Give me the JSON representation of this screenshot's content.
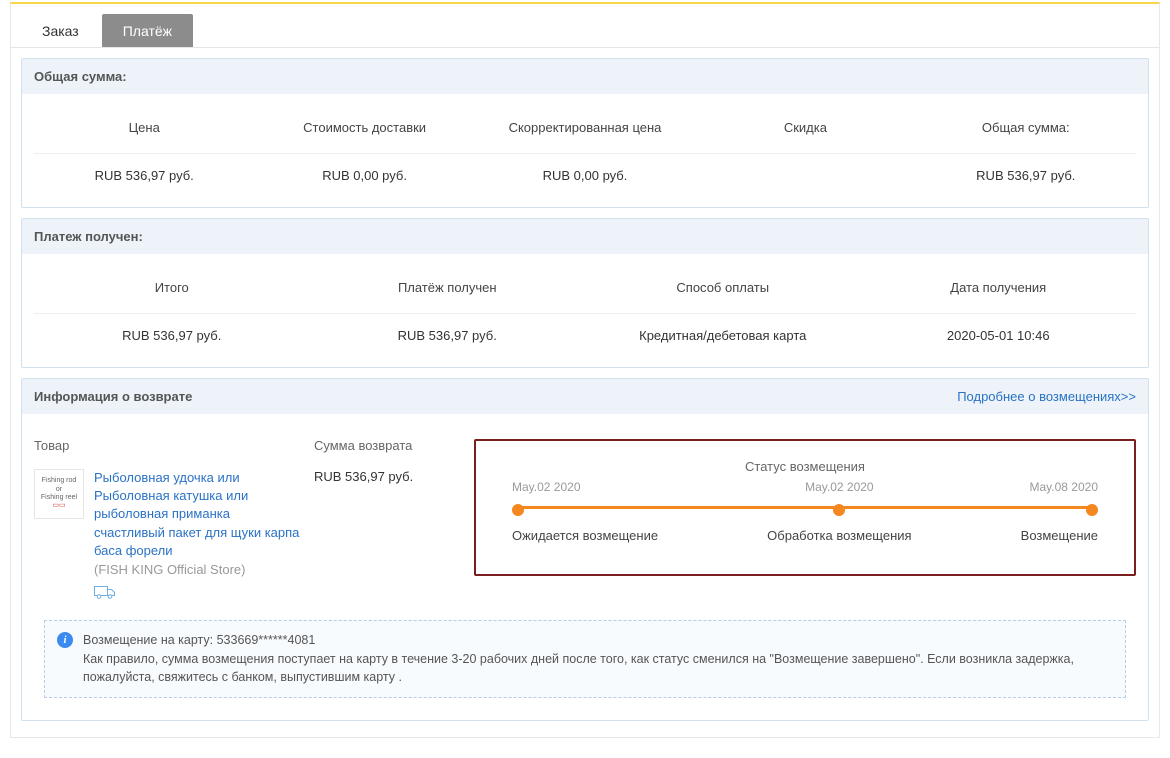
{
  "tabs": {
    "order": "Заказ",
    "payment": "Платёж"
  },
  "total": {
    "header": "Общая сумма:",
    "cols": {
      "price": "Цена",
      "ship": "Стоимость доставки",
      "adj": "Скорректированная цена",
      "disc": "Скидка",
      "total": "Общая сумма:"
    },
    "vals": {
      "price": "RUB 536,97 руб.",
      "ship": "RUB 0,00 руб.",
      "adj": "RUB 0,00 руб.",
      "disc": "",
      "total": "RUB 536,97 руб."
    }
  },
  "received": {
    "header": "Платеж получен:",
    "cols": {
      "total": "Итого",
      "recv": "Платёж получен",
      "method": "Способ оплаты",
      "date": "Дата получения"
    },
    "vals": {
      "total": "RUB 536,97 руб.",
      "recv": "RUB 536,97 руб.",
      "method": "Кредитная/дебетовая карта",
      "date": "2020-05-01 10:46"
    }
  },
  "refund": {
    "header": "Информация о возврате",
    "more": "Подробнее о возмещениях>>",
    "cols": {
      "product": "Товар",
      "amount": "Сумма возврата",
      "status": "Статус возмещения"
    },
    "product": {
      "title": "Рыболовная удочка или Рыболовная катушка или рыболовная приманка счастливый пакет для щуки карпа баса форели",
      "store": "(FISH KING Official Store)",
      "thumb1": "Fishing rod",
      "thumb_or": "or",
      "thumb2": "Fishing reel"
    },
    "amount": "RUB 536,97 руб.",
    "steps": [
      {
        "date": "May.02 2020",
        "label": "Ожидается возмещение"
      },
      {
        "date": "May.02 2020",
        "label": "Обработка возмещения"
      },
      {
        "date": "May.08 2020",
        "label": "Возмещение"
      }
    ],
    "notice": {
      "line1": "Возмещение на карту: 533669******4081",
      "line2": "Как правило, сумма возмещения поступает на карту в течение 3-20 рабочих дней после того, как статус сменился на \"Возмещение завершено\". Если возникла задержка, пожалуйста, свяжитесь с банком, выпустившим карту ."
    }
  }
}
